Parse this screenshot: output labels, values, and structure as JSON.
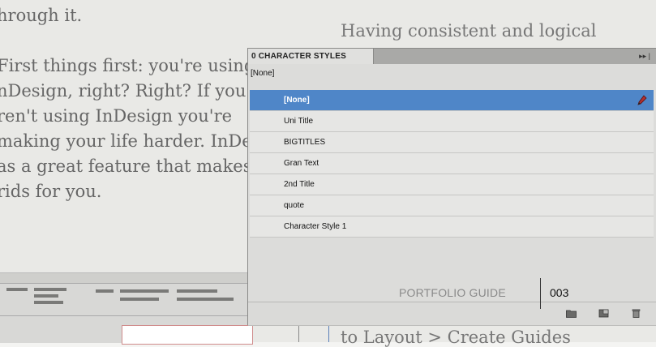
{
  "document": {
    "paragraphs": [
      [
        "hrough it."
      ],
      [
        "First things first: you're using",
        "nDesign, right? Right? If you",
        "ren't using InDesign you're",
        "making your life harder. InDe",
        "as a great feature that makes",
        "rids for you."
      ]
    ],
    "right_heading": "Having consistent and logical",
    "right_footer": "to Layout > Create Guides"
  },
  "panel": {
    "title": "0 CHARACTER STYLES",
    "menu_glyph": "▸▸ |",
    "current_style": "[None]",
    "styles": [
      {
        "label": "[None]",
        "selected": true
      },
      {
        "label": "Uni Title",
        "selected": false
      },
      {
        "label": "BIGTITLES",
        "selected": false
      },
      {
        "label": "Gran Text",
        "selected": false
      },
      {
        "label": "2nd Title",
        "selected": false
      },
      {
        "label": "quote",
        "selected": false
      },
      {
        "label": "Character Style 1",
        "selected": false
      }
    ],
    "footer_icons": [
      "new-group-folder-icon",
      "new-style-icon",
      "delete-style-icon"
    ],
    "selected_color": "#4f86c8"
  },
  "overlay": {
    "guide_label": "PORTFOLIO GUIDE",
    "page_number": "003"
  }
}
